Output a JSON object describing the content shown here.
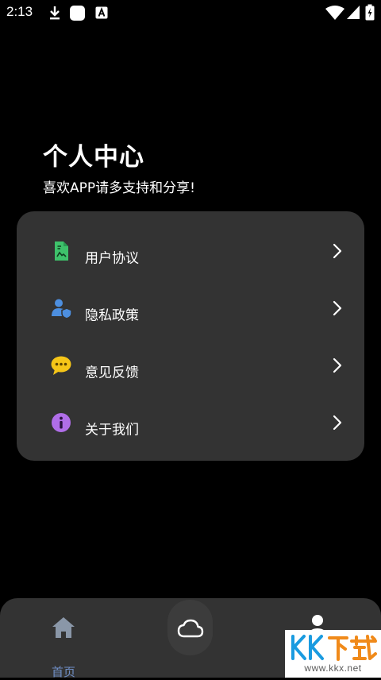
{
  "status_bar": {
    "time": "2:13",
    "left_icons": [
      "download-icon",
      "square-app-icon",
      "a-notification-icon"
    ],
    "right_icons": [
      "wifi-icon",
      "signal-icon",
      "battery-charging-icon"
    ]
  },
  "header": {
    "title": "个人中心",
    "subtitle": "喜欢APP请多支持和分享!"
  },
  "menu": {
    "items": [
      {
        "label": "用户协议",
        "icon": "document-icon",
        "color": "#3ec26b"
      },
      {
        "label": "隐私政策",
        "icon": "user-shield-icon",
        "color": "#4d8fe0"
      },
      {
        "label": "意见反馈",
        "icon": "chat-bubble-icon",
        "color": "#f5c518"
      },
      {
        "label": "关于我们",
        "icon": "info-icon",
        "color": "#b06ee8"
      }
    ]
  },
  "bottom_nav": {
    "items": [
      {
        "label": "首页",
        "icon": "home-icon",
        "active": true
      },
      {
        "label": "",
        "icon": "cloud-icon",
        "active": false
      },
      {
        "label": "",
        "icon": "person-icon",
        "active": false
      }
    ]
  },
  "watermark": {
    "logo_text": "KK下载",
    "url": "www.kkx.net"
  },
  "colors": {
    "background": "#000000",
    "card": "#333333",
    "nav_active": "#6f8ec4",
    "nav_inactive": "#9ea6b0"
  }
}
